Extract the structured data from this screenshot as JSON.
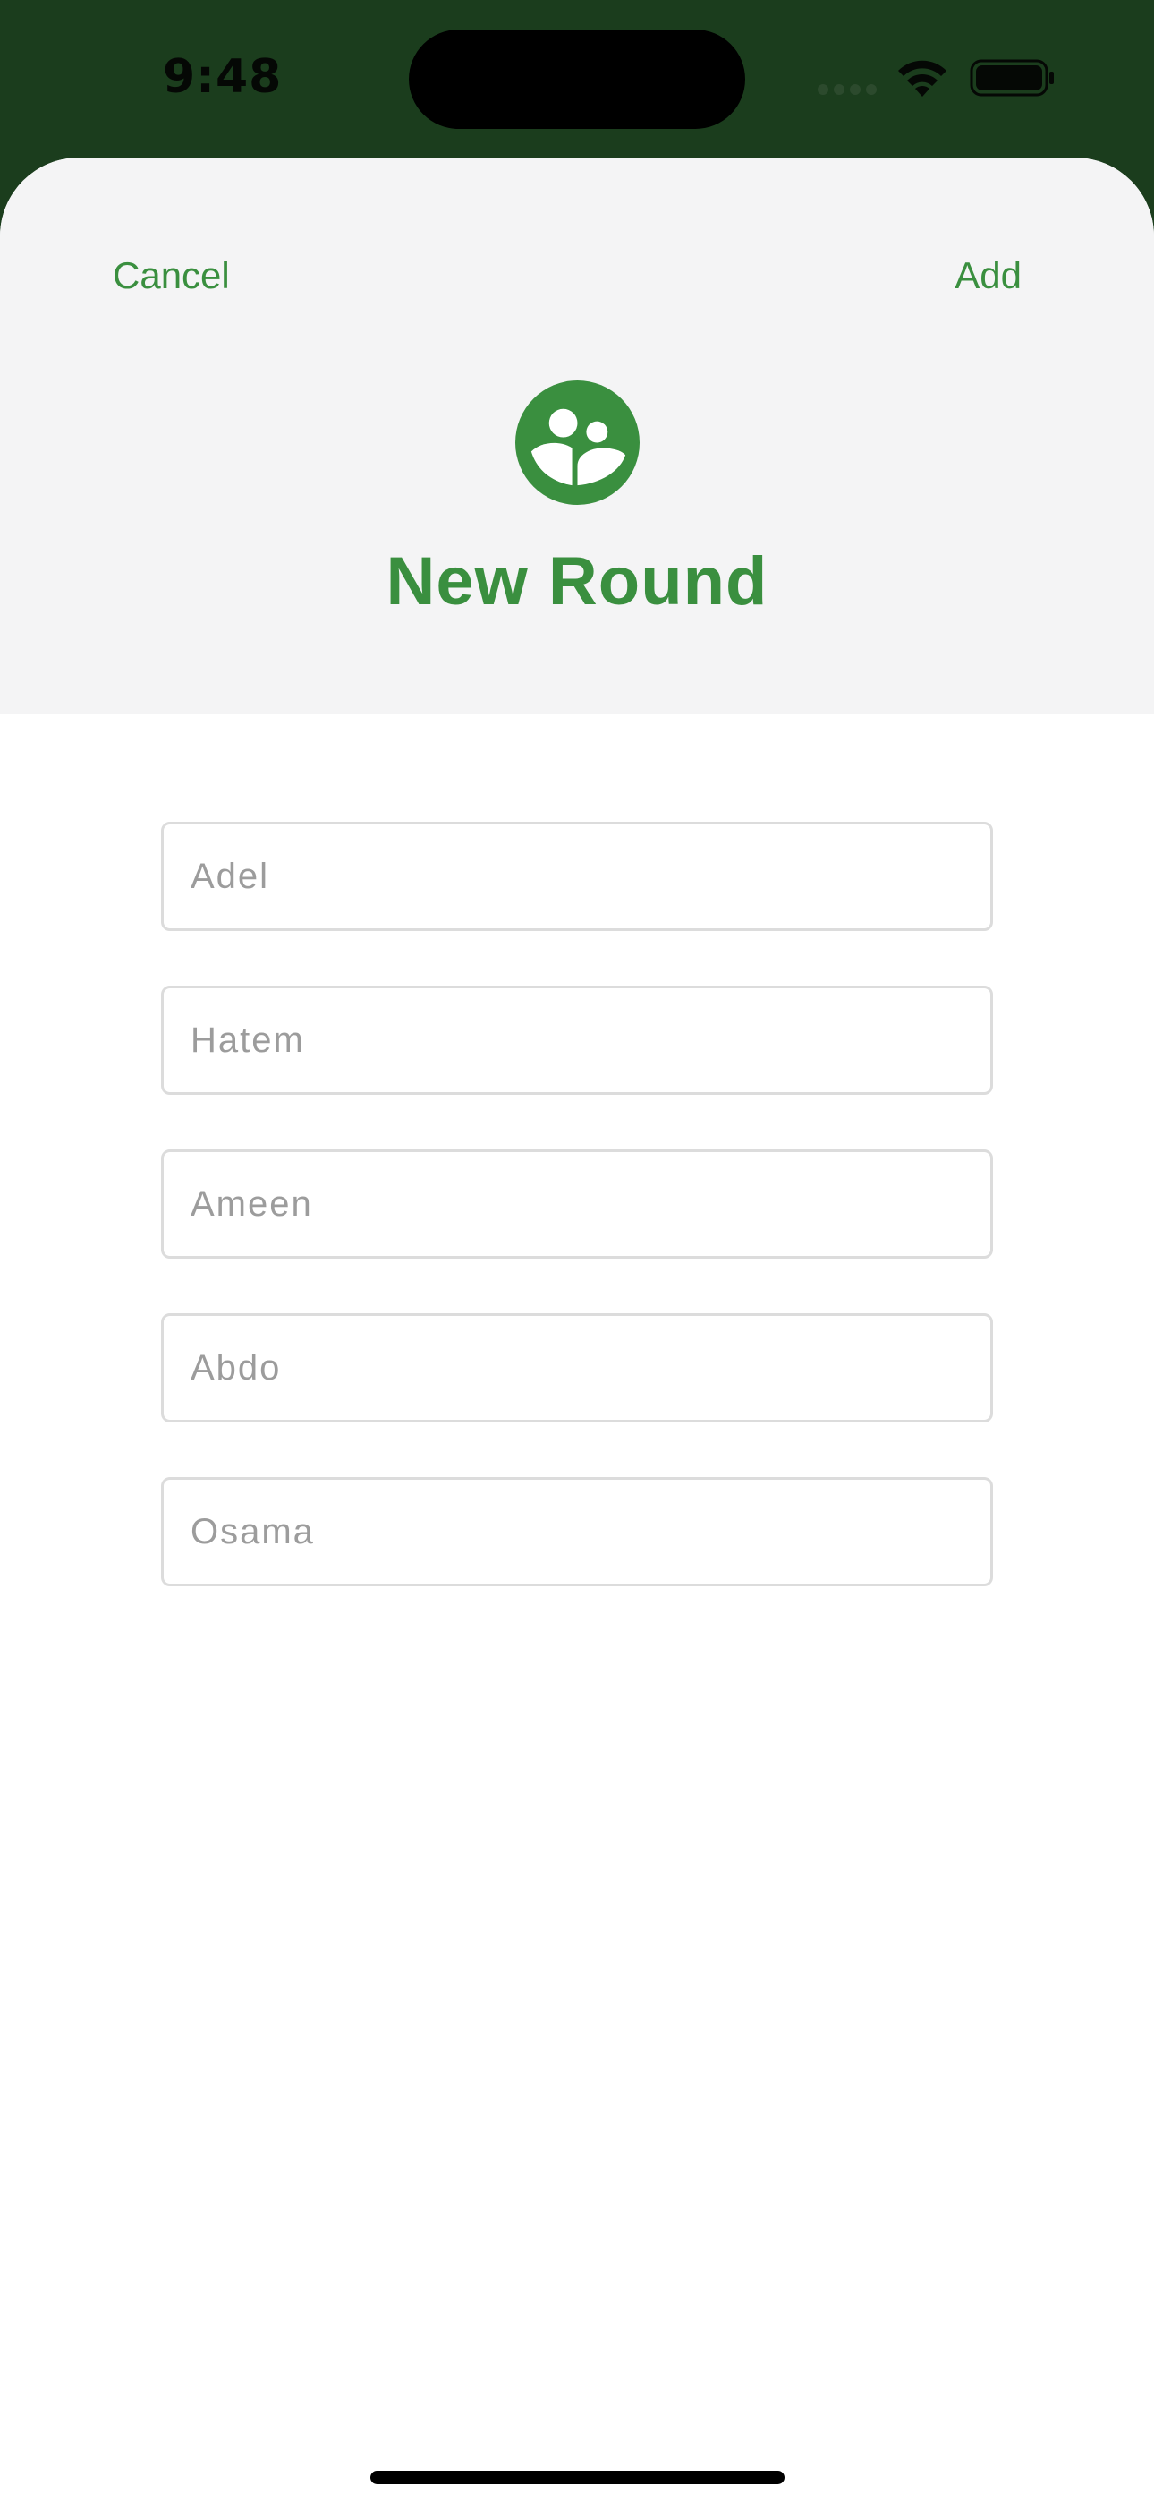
{
  "status_bar": {
    "time": "9:48",
    "icons": [
      "signal-icon",
      "wifi-icon",
      "battery-icon"
    ]
  },
  "header": {
    "cancel_label": "Cancel",
    "add_label": "Add",
    "icon": "group-icon",
    "title": "New Round"
  },
  "fields": [
    {
      "placeholder": "Adel",
      "value": ""
    },
    {
      "placeholder": "Hatem",
      "value": ""
    },
    {
      "placeholder": "Ameen",
      "value": ""
    },
    {
      "placeholder": "Abdo",
      "value": ""
    },
    {
      "placeholder": "Osama",
      "value": ""
    }
  ],
  "colors": {
    "accent": "#3a8f3f",
    "status_bar_bg": "#1b3d1d",
    "header_bg": "#f4f4f5"
  }
}
